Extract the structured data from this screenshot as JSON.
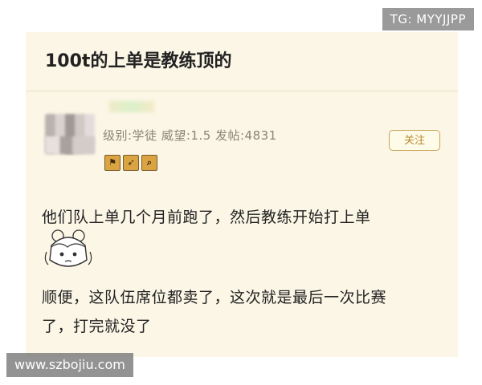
{
  "watermarks": {
    "top": "TG: MYYJJPP",
    "bottom": "www.szbojiu.com"
  },
  "post": {
    "title": "100t的上单是教练顶的",
    "content": [
      "他们队上单几个月前跑了，然后教练开始打上单",
      "顺便，这队伍席位都卖了，这次就是最后一次比赛",
      "了，打完就没了"
    ]
  },
  "user": {
    "meta": "级别:学徒  威望:1.5  发帖:4831",
    "badges": [
      "flag-badge-icon",
      "sword-badge-icon",
      "search-badge-icon"
    ],
    "follow_label": "关注"
  },
  "colors": {
    "card_background": "#fbf6e6",
    "accent": "#c9a45a"
  }
}
